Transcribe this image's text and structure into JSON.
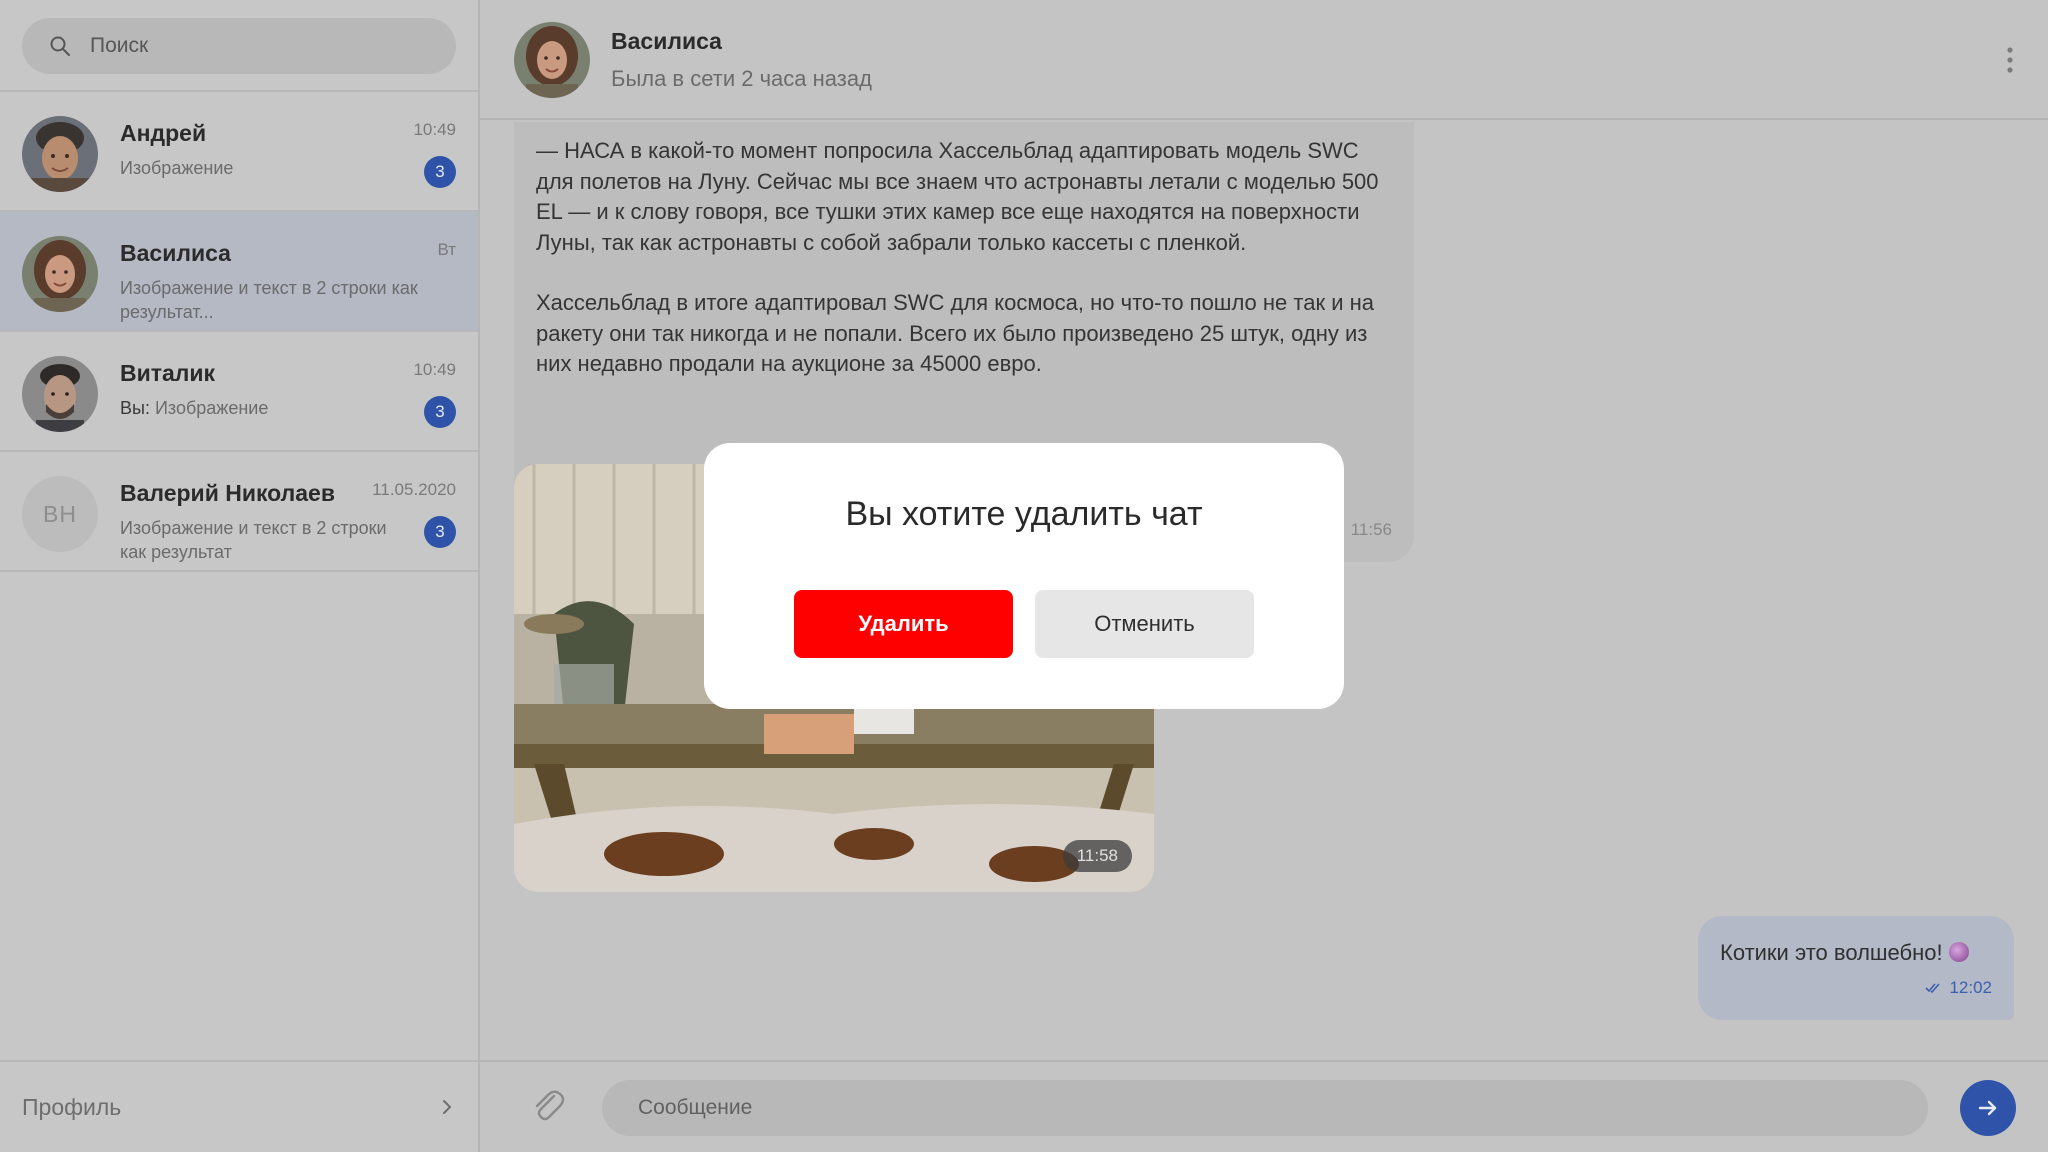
{
  "sidebar": {
    "search_placeholder": "Поиск",
    "chats": [
      {
        "name": "Андрей",
        "time": "10:49",
        "preview": "Изображение",
        "unread": "3"
      },
      {
        "name": "Василиса",
        "time": "Вт",
        "preview": "Изображение и текст в 2 строки как результат...",
        "unread": ""
      },
      {
        "name": "Виталик",
        "time": "10:49",
        "preview_prefix": "Вы:",
        "preview": "Изображение",
        "unread": "3"
      },
      {
        "name": "Валерий Николаев",
        "initials": "ВН",
        "time": "11.05.2020",
        "preview": "Изображение и текст в 2 строки как результат",
        "unread": "3"
      }
    ],
    "profile_label": "Профиль"
  },
  "header": {
    "name": "Василиса",
    "status": "Была в сети 2 часа назад"
  },
  "messages": {
    "incoming_text": {
      "paragraph_1": "— НАСА в какой-то момент попросила Хассельблад адаптировать модель SWC для полетов на Луну. Сейчас мы все знаем что астронавты летали с моделью 500 EL — и к слову говоря, все тушки этих камер все еще находятся на поверхности Луны, так как астронавты с собой забрали только кассеты с пленкой.",
      "paragraph_2": "Хассельблад в итоге адаптировал SWC для космоса, но что-то пошло не так и на ракету они так никогда и не попали. Всего их было произведено 25 штук, одну из них недавно продали на аукционе за 45000 евро.",
      "time": "11:56"
    },
    "incoming_image": {
      "time": "11:58"
    },
    "outgoing": {
      "text": "Котики это волшебно!",
      "time": "12:02"
    }
  },
  "composer": {
    "placeholder": "Сообщение"
  },
  "modal": {
    "title": "Вы хотите удалить чат",
    "delete_label": "Удалить",
    "cancel_label": "Отменить"
  },
  "colors": {
    "accent": "#2f53a8",
    "danger": "#ff0000",
    "overlay_bg": "#c4c4c4",
    "active_chat": "#b4b9c4"
  },
  "icons": [
    "search-icon",
    "chevron-right-icon",
    "more-vertical-icon",
    "attach-icon",
    "send-icon",
    "double-check-icon"
  ]
}
